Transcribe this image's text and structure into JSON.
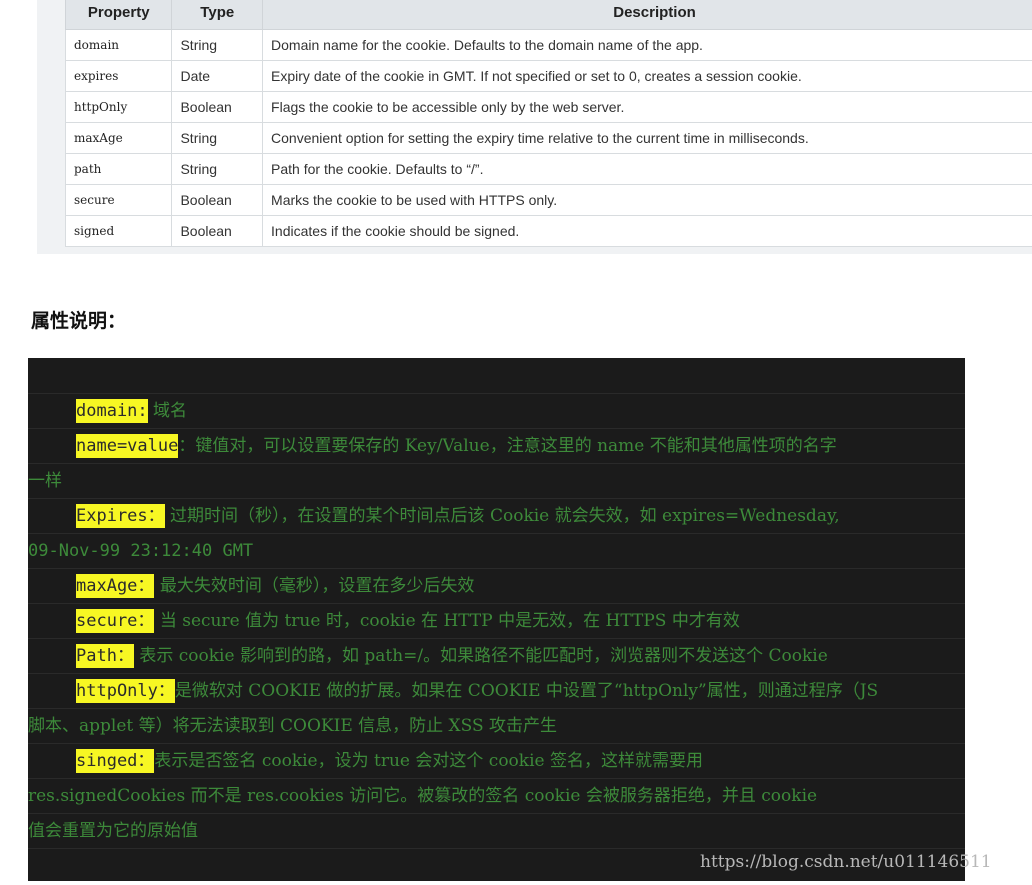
{
  "table": {
    "headers": [
      "Property",
      "Type",
      "Description"
    ],
    "rows": [
      {
        "property": "domain",
        "type": "String",
        "description": "Domain name for the cookie. Defaults to the domain name of the app."
      },
      {
        "property": "expires",
        "type": "Date",
        "description": "Expiry date of the cookie in GMT. If not specified or set to 0, creates a session cookie."
      },
      {
        "property": "httpOnly",
        "type": "Boolean",
        "description": "Flags the cookie to be accessible only by the web server."
      },
      {
        "property": "maxAge",
        "type": "String",
        "description": "Convenient option for setting the expiry time relative to the current time in milliseconds."
      },
      {
        "property": "path",
        "type": "String",
        "description": "Path for the cookie. Defaults to “/”."
      },
      {
        "property": "secure",
        "type": "Boolean",
        "description": "Marks the cookie to be used with HTTPS only."
      },
      {
        "property": "signed",
        "type": "Boolean",
        "description": "Indicates if the cookie should be signed."
      }
    ]
  },
  "heading": "属性说明：",
  "code": {
    "domain_key": "domain:",
    "domain_text": " 域名",
    "namevalue_key": "name=value",
    "namevalue_text": "：键值对，可以设置要保存的 Key/Value，注意这里的 name 不能和其他属性项的名字",
    "namevalue_cont": "一样",
    "expires_key": "Expires：",
    "expires_text": " 过期时间（秒），在设置的某个时间点后该 Cookie 就会失效，如 expires=Wednesday,",
    "expires_cont": "09-Nov-99 23:12:40 GMT",
    "maxage_key": "maxAge：",
    "maxage_text": " 最大失效时间（毫秒），设置在多少后失效",
    "secure_key": "secure：",
    "secure_text": " 当 secure 值为 true 时，cookie 在 HTTP 中是无效，在 HTTPS 中才有效",
    "path_key": "Path：",
    "path_text": " 表示 cookie 影响到的路，如 path=/。如果路径不能匹配时，浏览器则不发送这个 Cookie",
    "httponly_key": "httpOnly：",
    "httponly_text": "是微软对 COOKIE 做的扩展。如果在 COOKIE 中设置了“httpOnly”属性，则通过程序（JS",
    "httponly_cont": "脚本、applet 等）将无法读取到 COOKIE 信息，防止 XSS 攻击产生",
    "singed_key": "singed：",
    "singed_text": "表示是否签名 cookie，设为 true 会对这个 cookie 签名，这样就需要用",
    "singed_cont1": "res.signedCookies 而不是 res.cookies 访问它。被篡改的签名 cookie 会被服务器拒绝，并且 cookie",
    "singed_cont2": "值会重置为它的原始值"
  },
  "watermark": "https://blog.csdn.net/u011146511"
}
